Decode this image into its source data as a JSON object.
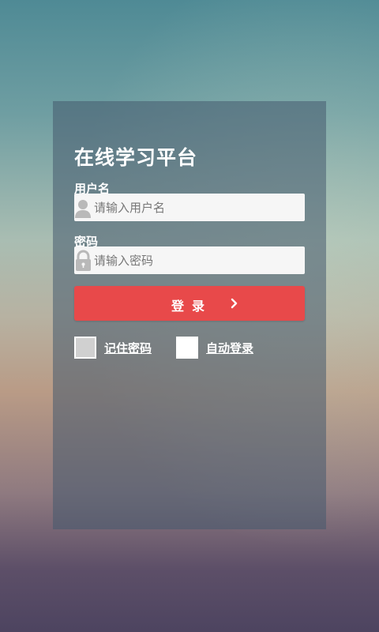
{
  "login": {
    "title": "在线学习平台",
    "username_label": "用户名",
    "username_placeholder": "请输入用户名",
    "password_label": "密码",
    "password_placeholder": "请输入密码",
    "login_button": "登录",
    "remember_password": "记住密码",
    "auto_login": "自动登录"
  },
  "colors": {
    "accent": "#e8494a",
    "panel": "#465a6e",
    "input_bg": "#f6f6f6"
  },
  "icons": {
    "username": "user-icon",
    "password": "lock-icon",
    "login_arrow": "chevron-right-icon"
  },
  "state": {
    "remember_password_checked": false,
    "auto_login_checked": false
  }
}
